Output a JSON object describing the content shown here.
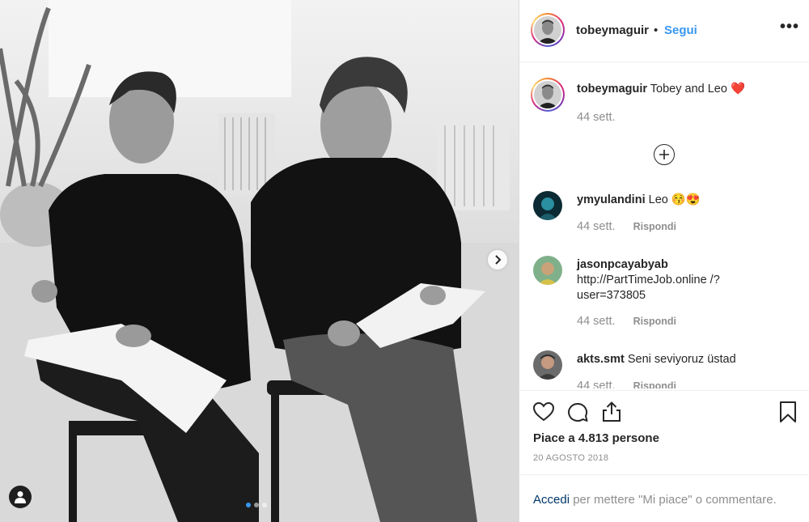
{
  "post": {
    "author": "tobeymaguir",
    "separator": "•",
    "follow_label": "Segui",
    "more_icon": "more-options-icon",
    "carousel": {
      "dot_count": 3,
      "active_index": 0
    }
  },
  "caption": {
    "username": "tobeymaguir",
    "text": "Tobey and Leo ❤️",
    "time": "44 sett."
  },
  "comments": [
    {
      "username": "ymyulandini",
      "text": "Leo 😚😍",
      "time": "44 sett.",
      "reply_label": "Rispondi"
    },
    {
      "username": "jasonpcayabyab",
      "text": "http://PartTimeJob.online /?user=373805",
      "time": "44 sett.",
      "reply_label": "Rispondi"
    },
    {
      "username": "akts.smt",
      "text": "Seni seviyoruz üstad",
      "time": "44 sett.",
      "reply_label": "Rispondi"
    }
  ],
  "engagement": {
    "likes_text": "Piace a 4.813 persone",
    "date": "20 AGOSTO 2018"
  },
  "login_prompt": {
    "link": "Accedi",
    "rest": " per mettere \"Mi piace\" o commentare."
  },
  "colors": {
    "link_blue": "#3897f0",
    "text_dark": "#262626",
    "text_muted": "#8e8e8e",
    "heart_red": "#ed4956"
  }
}
